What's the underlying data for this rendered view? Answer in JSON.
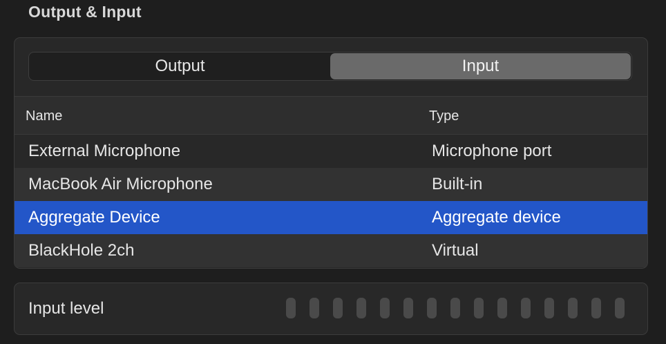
{
  "section": {
    "title": "Output & Input"
  },
  "tabs": [
    {
      "label": "Output",
      "selected": false
    },
    {
      "label": "Input",
      "selected": true
    }
  ],
  "table": {
    "columns": [
      "Name",
      "Type"
    ],
    "rows": [
      {
        "name": "External Microphone",
        "type": "Microphone port",
        "selected": false
      },
      {
        "name": "MacBook Air Microphone",
        "type": "Built-in",
        "selected": false
      },
      {
        "name": "Aggregate Device",
        "type": "Aggregate device",
        "selected": true
      },
      {
        "name": "BlackHole 2ch",
        "type": "Virtual",
        "selected": false
      }
    ]
  },
  "input_level": {
    "label": "Input level",
    "segments": 15,
    "active_segments": 0
  },
  "colors": {
    "selection": "#2356c8",
    "background": "#1e1e1e",
    "panel": "#282828",
    "meter_off": "#4a4a4a"
  }
}
